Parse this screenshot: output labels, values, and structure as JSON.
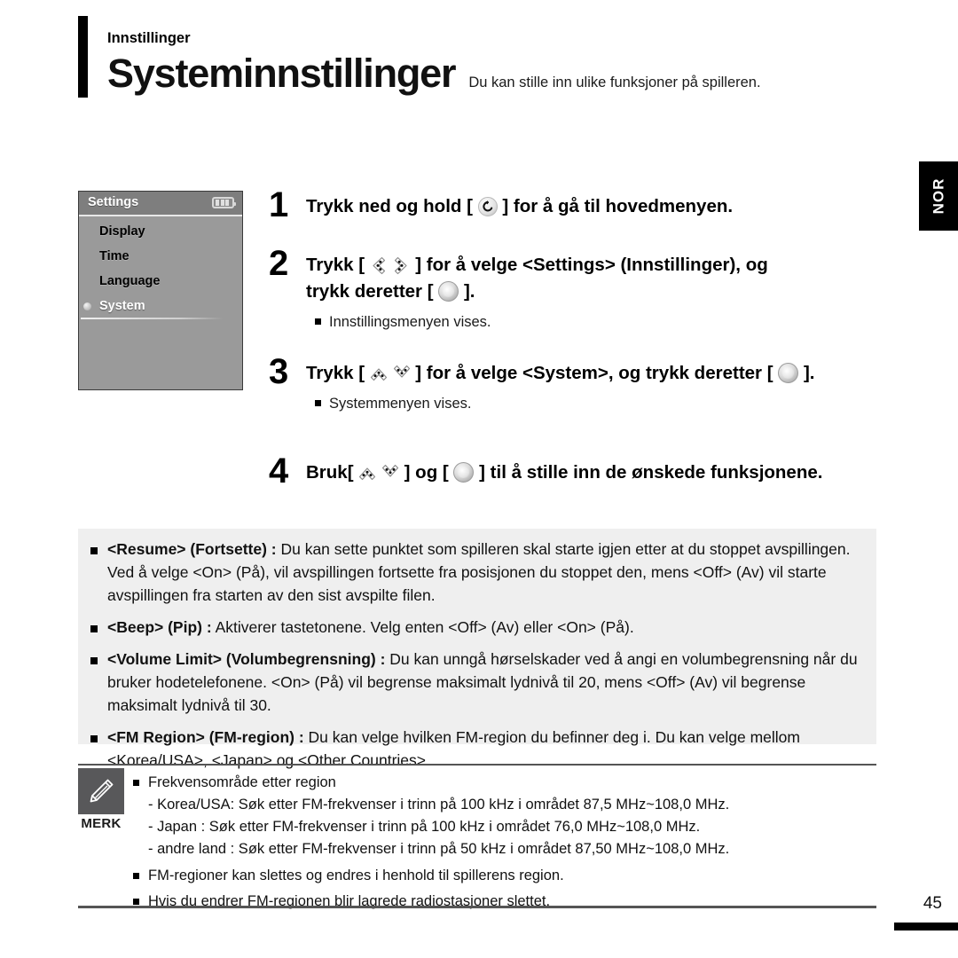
{
  "header": {
    "eyebrow": "Innstillinger",
    "title": "Systeminnstillinger",
    "subtitle": "Du kan stille inn ulike funksjoner på spilleren."
  },
  "language_tab": {
    "label": "NOR"
  },
  "device_screen": {
    "title": "Settings",
    "battery_icon": "battery-icon",
    "items": [
      {
        "label": "Display",
        "selected": false
      },
      {
        "label": "Time",
        "selected": false
      },
      {
        "label": "Language",
        "selected": false
      },
      {
        "label": "System",
        "selected": true
      }
    ]
  },
  "steps": [
    {
      "number": "1",
      "text_before": "Trykk ned og hold [",
      "icon": "return-icon",
      "text_after": "] for å gå til hovedmenyen.",
      "notes": []
    },
    {
      "number": "2",
      "text_before": "Trykk [",
      "icon": "left-right-chevron-icon",
      "text_mid": "] for å velge <Settings> (Innstillinger), og",
      "text_line2_before": "trykk deretter [",
      "icon2": "select-icon",
      "text_after": "].",
      "notes": [
        "Innstillingsmenyen vises."
      ]
    },
    {
      "number": "3",
      "text_before": "Trykk [",
      "icon": "up-down-chevron-icon",
      "text_mid": "] for å velge <System>, og trykk deretter [",
      "icon2": "select-icon",
      "text_after": "].",
      "notes": [
        "Systemmenyen vises."
      ]
    },
    {
      "number": "4",
      "text_before": "Bruk[",
      "icon": "up-down-chevron-icon",
      "text_mid": "] og [",
      "icon2": "select-icon",
      "text_after": "] til å stille inn de ønskede funksjonene.",
      "notes": []
    }
  ],
  "info_items": [
    {
      "bold": "<Resume> (Fortsette) :",
      "rest": " Du kan sette punktet som spilleren skal starte igjen etter at du stoppet avspillingen. Ved å velge <On> (På), vil avspillingen fortsette fra posisjonen du stoppet den, mens <Off> (Av) vil starte avspillingen fra starten av den sist avspilte filen."
    },
    {
      "bold": "<Beep> (Pip) :",
      "rest": " Aktiverer tastetonene. Velg enten <Off> (Av) eller <On> (På)."
    },
    {
      "bold": "<Volume Limit> (Volumbegrensning) :",
      "rest": " Du kan unngå hørselskader ved å angi en volumbegrensning når du bruker hodetelefonene. <On> (På) vil begrense maksimalt lydnivå til 20, mens <Off> (Av) vil begrense maksimalt lydnivå til 30."
    },
    {
      "bold": "<FM Region> (FM-region) :",
      "rest": " Du kan velge hvilken FM-region du befinner deg i. Du kan velge mellom <Korea/USA>, <Japan> og <Other Countries>."
    }
  ],
  "merk": {
    "icon": "pencil-icon",
    "label": "MERK",
    "first_item": "Frekvensområde etter region",
    "sub_items": [
      "- Korea/USA: Søk etter FM-frekvenser i trinn på 100 kHz i området 87,5 MHz~108,0 MHz.",
      "- Japan : Søk etter FM-frekvenser i trinn på 100 kHz i området 76,0 MHz~108,0 MHz.",
      "- andre land : Søk etter FM-frekvenser i trinn på 50 kHz i området 87,50 MHz~108,0 MHz."
    ],
    "items": [
      "FM-regioner kan slettes og endres i henhold til spillerens region.",
      "Hvis du endrer FM-regionen blir lagrede radiostasjoner slettet."
    ]
  },
  "footer": {
    "page_number": "45"
  }
}
